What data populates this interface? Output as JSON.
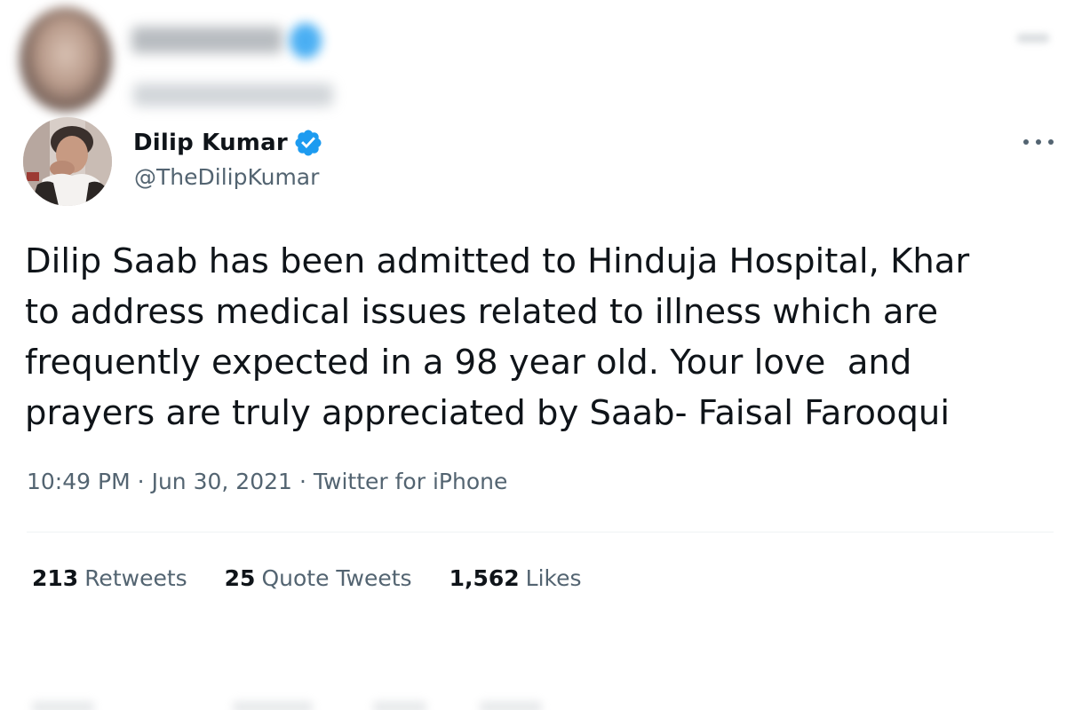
{
  "author": {
    "display_name": "Dilip Kumar",
    "handle": "@TheDilipKumar",
    "verified": true
  },
  "tweet": {
    "text": "Dilip Saab has been admitted to Hinduja Hospital, Khar\nto address medical issues related to illness which are\nfrequently expected in a 98 year old. Your love  and\nprayers are truly appreciated by Saab- Faisal Farooqui"
  },
  "meta": {
    "time": "10:49 PM",
    "separator": "·",
    "date": "Jun 30, 2021",
    "source": "Twitter for iPhone"
  },
  "stats": [
    {
      "count": "213",
      "label": "Retweets"
    },
    {
      "count": "25",
      "label": "Quote Tweets"
    },
    {
      "count": "1,562",
      "label": "Likes"
    }
  ],
  "icons": {
    "verified": "verified-badge-icon",
    "more": "more-options-icon"
  },
  "colors": {
    "text_primary": "#0f1419",
    "text_secondary": "#536471",
    "verified_blue": "#1d9bf0",
    "divider": "#eff3f4"
  }
}
